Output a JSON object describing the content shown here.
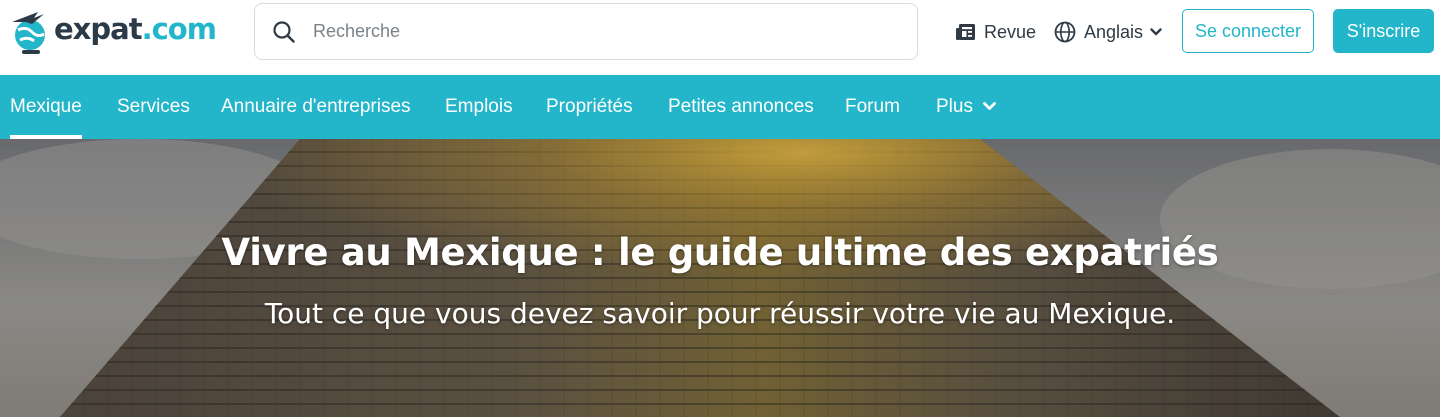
{
  "header": {
    "logo": {
      "name": "expat",
      "tld": ".com",
      "icon": "globe-plane-logo"
    },
    "search": {
      "placeholder": "Recherche",
      "value": "",
      "icon": "search-icon"
    },
    "revue_label": "Revue",
    "language_label": "Anglais",
    "login_label": "Se connecter",
    "signup_label": "S'inscrire"
  },
  "nav": {
    "items": [
      {
        "label": "Mexique",
        "active": true
      },
      {
        "label": "Services"
      },
      {
        "label": "Annuaire d'entreprises"
      },
      {
        "label": "Emplois"
      },
      {
        "label": "Propriétés"
      },
      {
        "label": "Petites annonces"
      },
      {
        "label": "Forum"
      },
      {
        "label": "Plus"
      }
    ]
  },
  "hero": {
    "title": "Vivre au Mexique : le guide ultime des expatriés",
    "subtitle": "Tout ce que vous devez savoir pour réussir votre vie au Mexique."
  },
  "colors": {
    "brand": "#23b5c9",
    "text_dark": "#2b3a47"
  }
}
